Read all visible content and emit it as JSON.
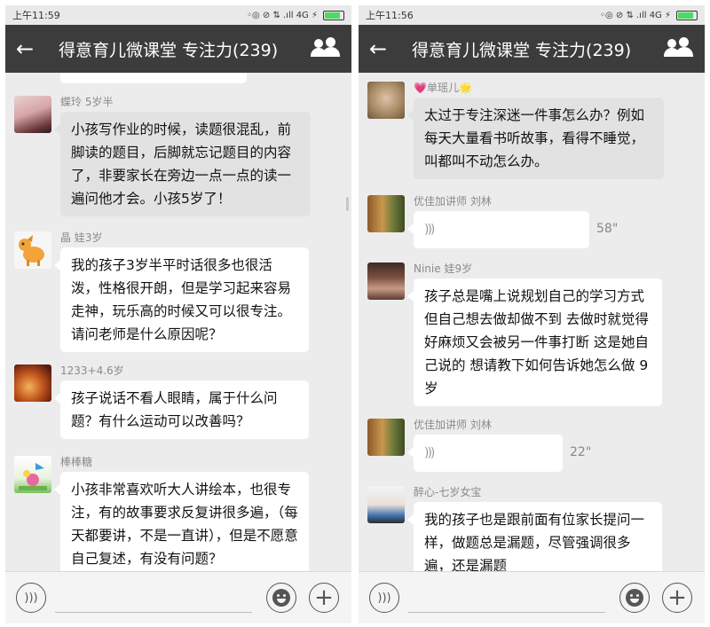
{
  "left": {
    "status": {
      "time": "上午11:59",
      "icons": "◦◎ ⊘ ⇅ .ıll 4G ⚡"
    },
    "header": {
      "back": "←",
      "title": "得意育儿微课堂 专注力(239)"
    },
    "messages": [
      {
        "sender": "蝶玲 5岁半",
        "text": "小孩写作业的时候，读题很混乱，前脚读的题目，后脚就忘记题目的内容了，非要家长在旁边一点一点的读一遍问他才会。小孩5岁了！",
        "style": "gray"
      },
      {
        "sender": "晶 娃3岁",
        "text": "我的孩子3岁半平时话很多也很活泼，性格很开朗，但是学习起来容易走神，玩乐高的时候又可以很专注。请问老师是什么原因呢？",
        "style": "white"
      },
      {
        "sender": "1233+4.6岁",
        "text": "孩子说话不看人眼睛，属于什么问题？有什么运动可以改善吗？",
        "style": "white"
      },
      {
        "sender": "棒棒糖",
        "text": "小孩非常喜欢听大人讲绘本，也很专注，有的故事要求反复讲很多遍，（每天都要讲，不是一直讲），但是不愿意自己复述，有没有问题？",
        "style": "white"
      }
    ]
  },
  "right": {
    "status": {
      "time": "上午11:56",
      "icons": "◦◎ ⊘ ⇅ .ıll 4G ⚡"
    },
    "header": {
      "back": "←",
      "title": "得意育儿微课堂 专注力(239)"
    },
    "messages": [
      {
        "sender": "💗单瑶儿🌟",
        "text": "太过于专注深迷一件事怎么办？例如每天大量看书听故事，看得不睡觉，叫都叫不动怎么办。",
        "style": "gray"
      },
      {
        "sender": "优佳加讲师  刘林",
        "voice": ")))",
        "duration": "58\""
      },
      {
        "sender": "Ninie 娃9岁",
        "text": "孩子总是嘴上说规划自己的学习方式 但自己想去做却做不到 去做时就觉得好麻烦又会被另一件事打断 这是她自己说的 想请教下如何告诉她怎么做 9岁",
        "style": "white"
      },
      {
        "sender": "优佳加讲师  刘林",
        "voice": ")))",
        "duration": "22\""
      },
      {
        "sender": "醉心-七岁女宝",
        "text": "我的孩子也是跟前面有位家长提问一样，做题总是漏题，尽管强调很多遍，还是漏题",
        "style": "white"
      }
    ]
  },
  "input": {
    "voice_glyph": ")))",
    "plus_glyph": "+"
  },
  "colors": {
    "header_bg": "#3c3c3c",
    "chat_bg": "#ececec",
    "bubble_white": "#ffffff",
    "bubble_gray": "#e2e2e2",
    "battery": "#4cd964"
  },
  "icons": [
    "back-arrow-icon",
    "group-members-icon",
    "voice-input-icon",
    "emoji-icon",
    "plus-icon",
    "voice-wave-icon"
  ]
}
